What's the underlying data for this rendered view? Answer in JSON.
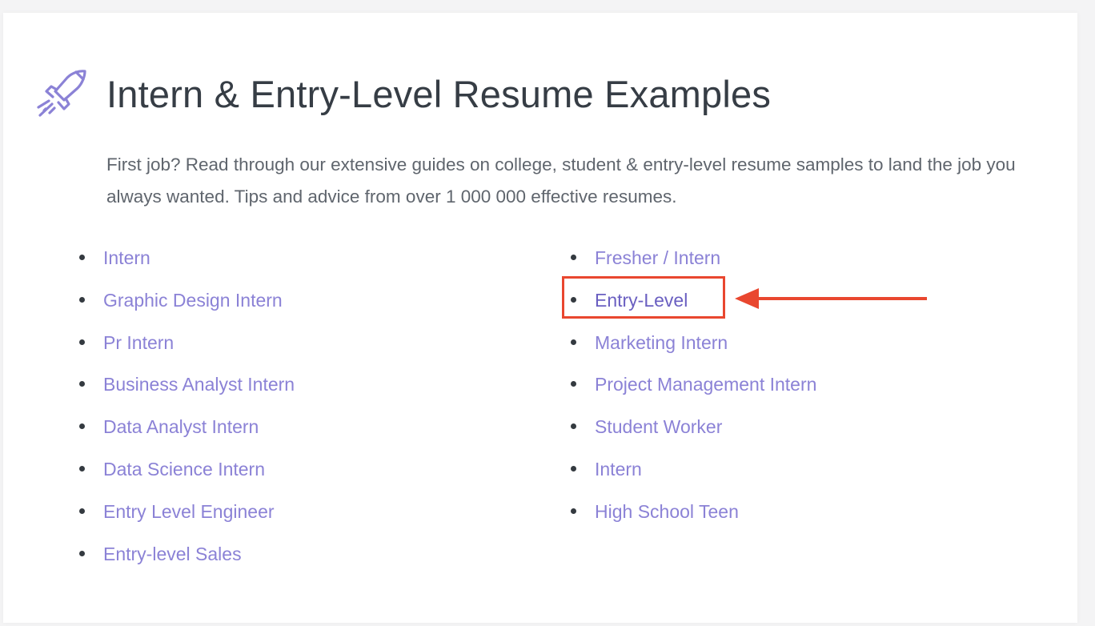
{
  "header": {
    "icon": "rocket-icon",
    "title": "Intern & Entry-Level Resume Examples",
    "description": "First job? Read through our extensive guides on college, student & entry-level resume samples to land the job you always wanted. Tips and advice from over 1 000 000 effective resumes."
  },
  "links": {
    "left": [
      {
        "label": "Intern"
      },
      {
        "label": "Graphic Design Intern"
      },
      {
        "label": "Pr Intern"
      },
      {
        "label": "Business Analyst Intern"
      },
      {
        "label": "Data Analyst Intern"
      },
      {
        "label": "Data Science Intern"
      },
      {
        "label": "Entry Level Engineer"
      },
      {
        "label": "Entry-level Sales"
      }
    ],
    "right": [
      {
        "label": "Fresher / Intern"
      },
      {
        "label": "Entry-Level"
      },
      {
        "label": "Marketing Intern"
      },
      {
        "label": "Project Management Intern"
      },
      {
        "label": "Student Worker"
      },
      {
        "label": "Intern"
      },
      {
        "label": "High School Teen"
      }
    ]
  },
  "annotation": {
    "highlighted_item": "Entry-Level",
    "color": "#e9472f"
  },
  "colors": {
    "accent": "#8b82d6",
    "title": "#363d45",
    "text": "#5f656d"
  }
}
